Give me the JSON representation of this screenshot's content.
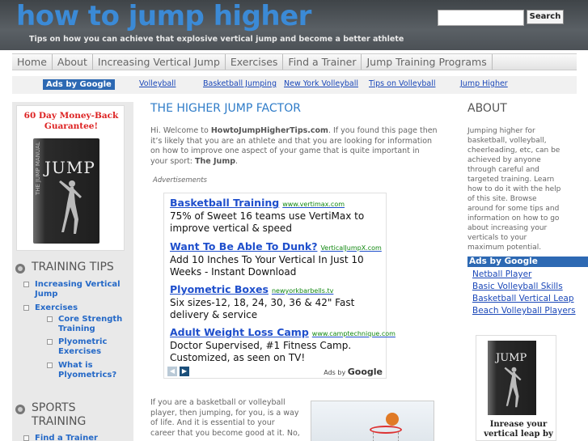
{
  "header": {
    "site_title": "how to jump higher",
    "tagline": "Tips on how you can achieve that explosive vertical jump and become a better athlete",
    "search_placeholder": "",
    "search_button": "Search"
  },
  "nav": {
    "items": [
      "Home",
      "About",
      "Increasing Vertical Jump",
      "Exercises",
      "Find a Trainer",
      "Jump Training Programs"
    ]
  },
  "link_unit": {
    "label": "Ads by Google",
    "links": [
      "Volleyball",
      "Basketball Jumping",
      "New York Volleyball",
      "Tips on Volleyball",
      "Jump Higher"
    ]
  },
  "left": {
    "product": {
      "guarantee_line1": "60 Day Money-Back",
      "guarantee_line2": "Guarantee!",
      "book_title": "JUMP",
      "book_spine": "THE JUMP MANUAL"
    },
    "training_tips": {
      "heading": "TRAINING TIPS",
      "items": [
        "Increasing Vertical Jump",
        "Exercises"
      ],
      "subitems": [
        "Core Strength Training",
        "Plyometric Exercises",
        "What is Plyometrics?"
      ]
    },
    "sports_training": {
      "heading": "SPORTS TRAINING",
      "items": [
        "Find a Trainer"
      ]
    }
  },
  "main": {
    "title": "THE HIGHER JUMP FACTOR",
    "intro_part1": "Hi. Welcome to ",
    "intro_site": "HowtoJumpHigherTips.com",
    "intro_part2": ". If you found this page then it’s likely that you are an athlete and that you are looking for information on how to improve one aspect of your game that is quite important in your sport: ",
    "intro_bold": "The Jump",
    "intro_end": ".",
    "advertisements_label": "Advertisements",
    "ads": [
      {
        "title": "Basketball Training",
        "url": "www.vertimax.com",
        "body": "75% of Sweet 16 teams use VertiMax to improve vertical & speed"
      },
      {
        "title": "Want To Be Able To Dunk?",
        "url": "VerticalJumpX.com",
        "body": "Add 10 Inches To Your Vertical In Just 10 Weeks - Instant Download"
      },
      {
        "title": "Plyometric Boxes",
        "url": "newyorkbarbells.tv",
        "body": "Six sizes-12, 18, 24, 30, 36 & 42\" Fast delivery & service"
      },
      {
        "title": "Adult Weight Loss Camp",
        "url": "www.camptechnique.com",
        "body": "Doctor Supervised, #1 Fitness Camp. Customized, as seen on TV!"
      }
    ],
    "ads_by_label": "Ads by",
    "ads_by_brand": "Google",
    "para2": "If you are a basketball or volleyball player, then jumping, for you, is a way of life. And it is essential to your career that you become good at it. No,"
  },
  "right": {
    "about_title": "ABOUT",
    "about_text": "Jumping higher for basketball, volleyball, cheerleading, etc, can be achieved by anyone through careful and targeted training. Learn how to do it with the help of this site. Browse around for some tips and information on how to go about increasing your verticals to your maximum potential.",
    "ads_label": "Ads by Google",
    "links": [
      "Netball Player",
      "Basic Volleyball Skills",
      "Basketball Vertical Leap",
      "Beach Volleyball Players"
    ],
    "product_title": "JUMP",
    "product_caption": "Inrease your vertical leap by"
  },
  "colors": {
    "title_blue": "#3b8ad6",
    "link_blue": "#1a47b8",
    "ad_label_blue": "#2d69b3",
    "ad_url_green": "#118811"
  }
}
